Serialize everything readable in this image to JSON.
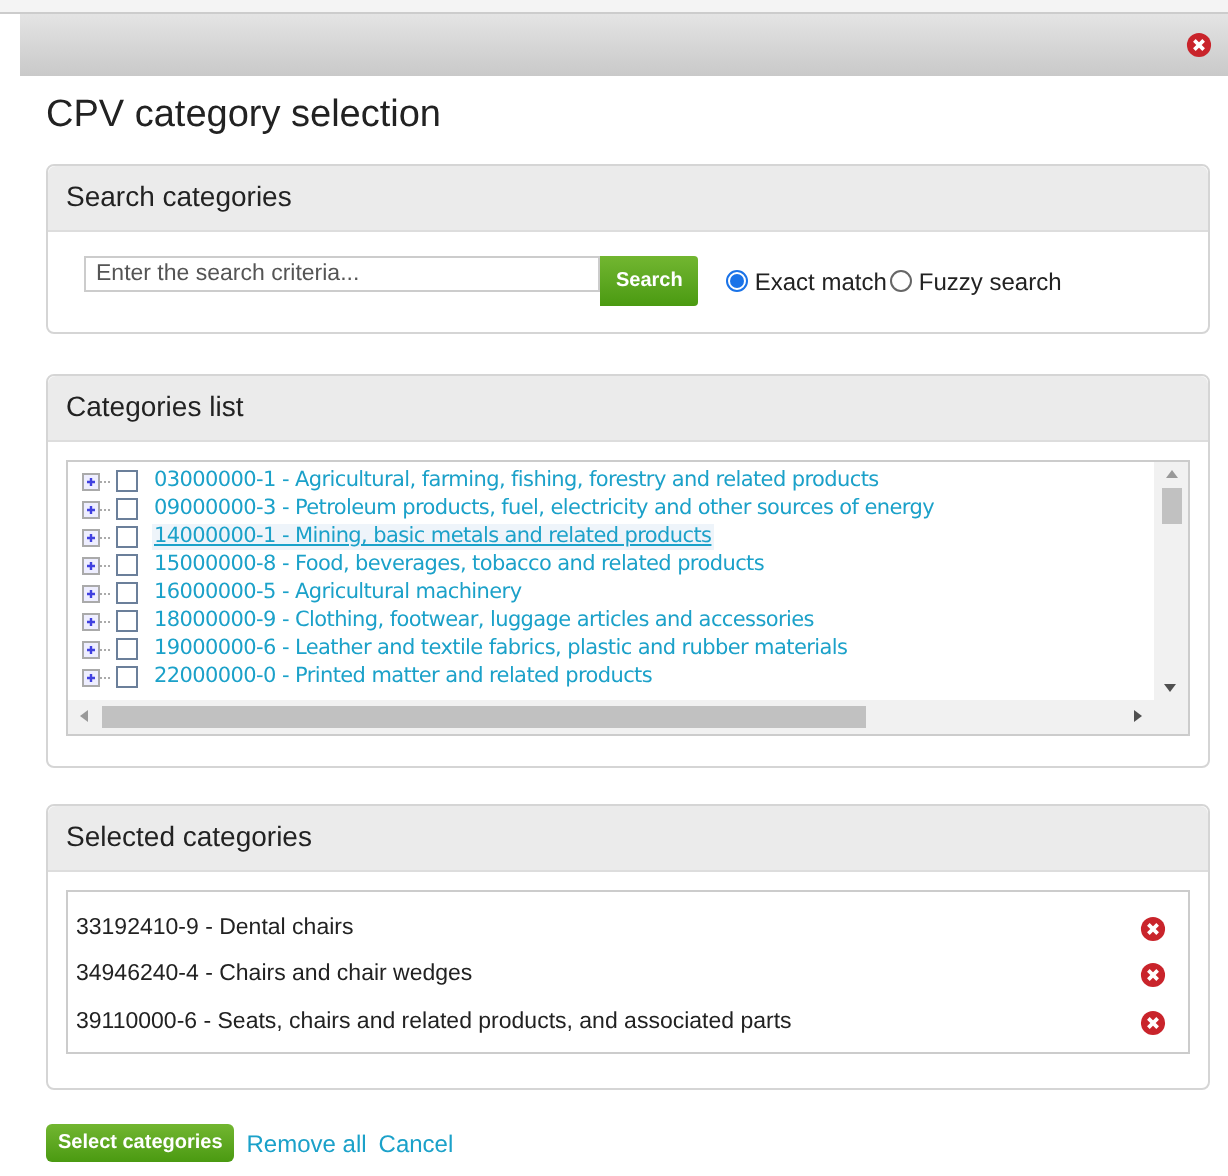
{
  "dialog": {
    "title": "CPV category selection"
  },
  "search": {
    "header": "Search categories",
    "placeholder": "Enter the search criteria...",
    "button": "Search",
    "modes": [
      {
        "label": "Exact match",
        "selected": true
      },
      {
        "label": "Fuzzy search",
        "selected": false
      }
    ]
  },
  "categories": {
    "header": "Categories list",
    "items": [
      {
        "label": "03000000-1 - Agricultural, farming, fishing, forestry and related products",
        "checked": false,
        "hovered": false
      },
      {
        "label": "09000000-3 - Petroleum products, fuel, electricity and other sources of energy",
        "checked": false,
        "hovered": false
      },
      {
        "label": "14000000-1 - Mining, basic metals and related products",
        "checked": false,
        "hovered": true
      },
      {
        "label": "15000000-8 - Food, beverages, tobacco and related products",
        "checked": false,
        "hovered": false
      },
      {
        "label": "16000000-5 - Agricultural machinery",
        "checked": false,
        "hovered": false
      },
      {
        "label": "18000000-9 - Clothing, footwear, luggage articles and accessories",
        "checked": false,
        "hovered": false
      },
      {
        "label": "19000000-6 - Leather and textile fabrics, plastic and rubber materials",
        "checked": false,
        "hovered": false
      },
      {
        "label": "22000000-0 - Printed matter and related products",
        "checked": false,
        "hovered": false
      }
    ]
  },
  "selected": {
    "header": "Selected categories",
    "items": [
      "33192410-9 - Dental chairs",
      "34946240-4 - Chairs and chair wedges",
      "39110000-6 - Seats, chairs and related products, and associated parts"
    ]
  },
  "actions": {
    "primary": "Select categories",
    "links": [
      "Remove all",
      "Cancel"
    ]
  }
}
